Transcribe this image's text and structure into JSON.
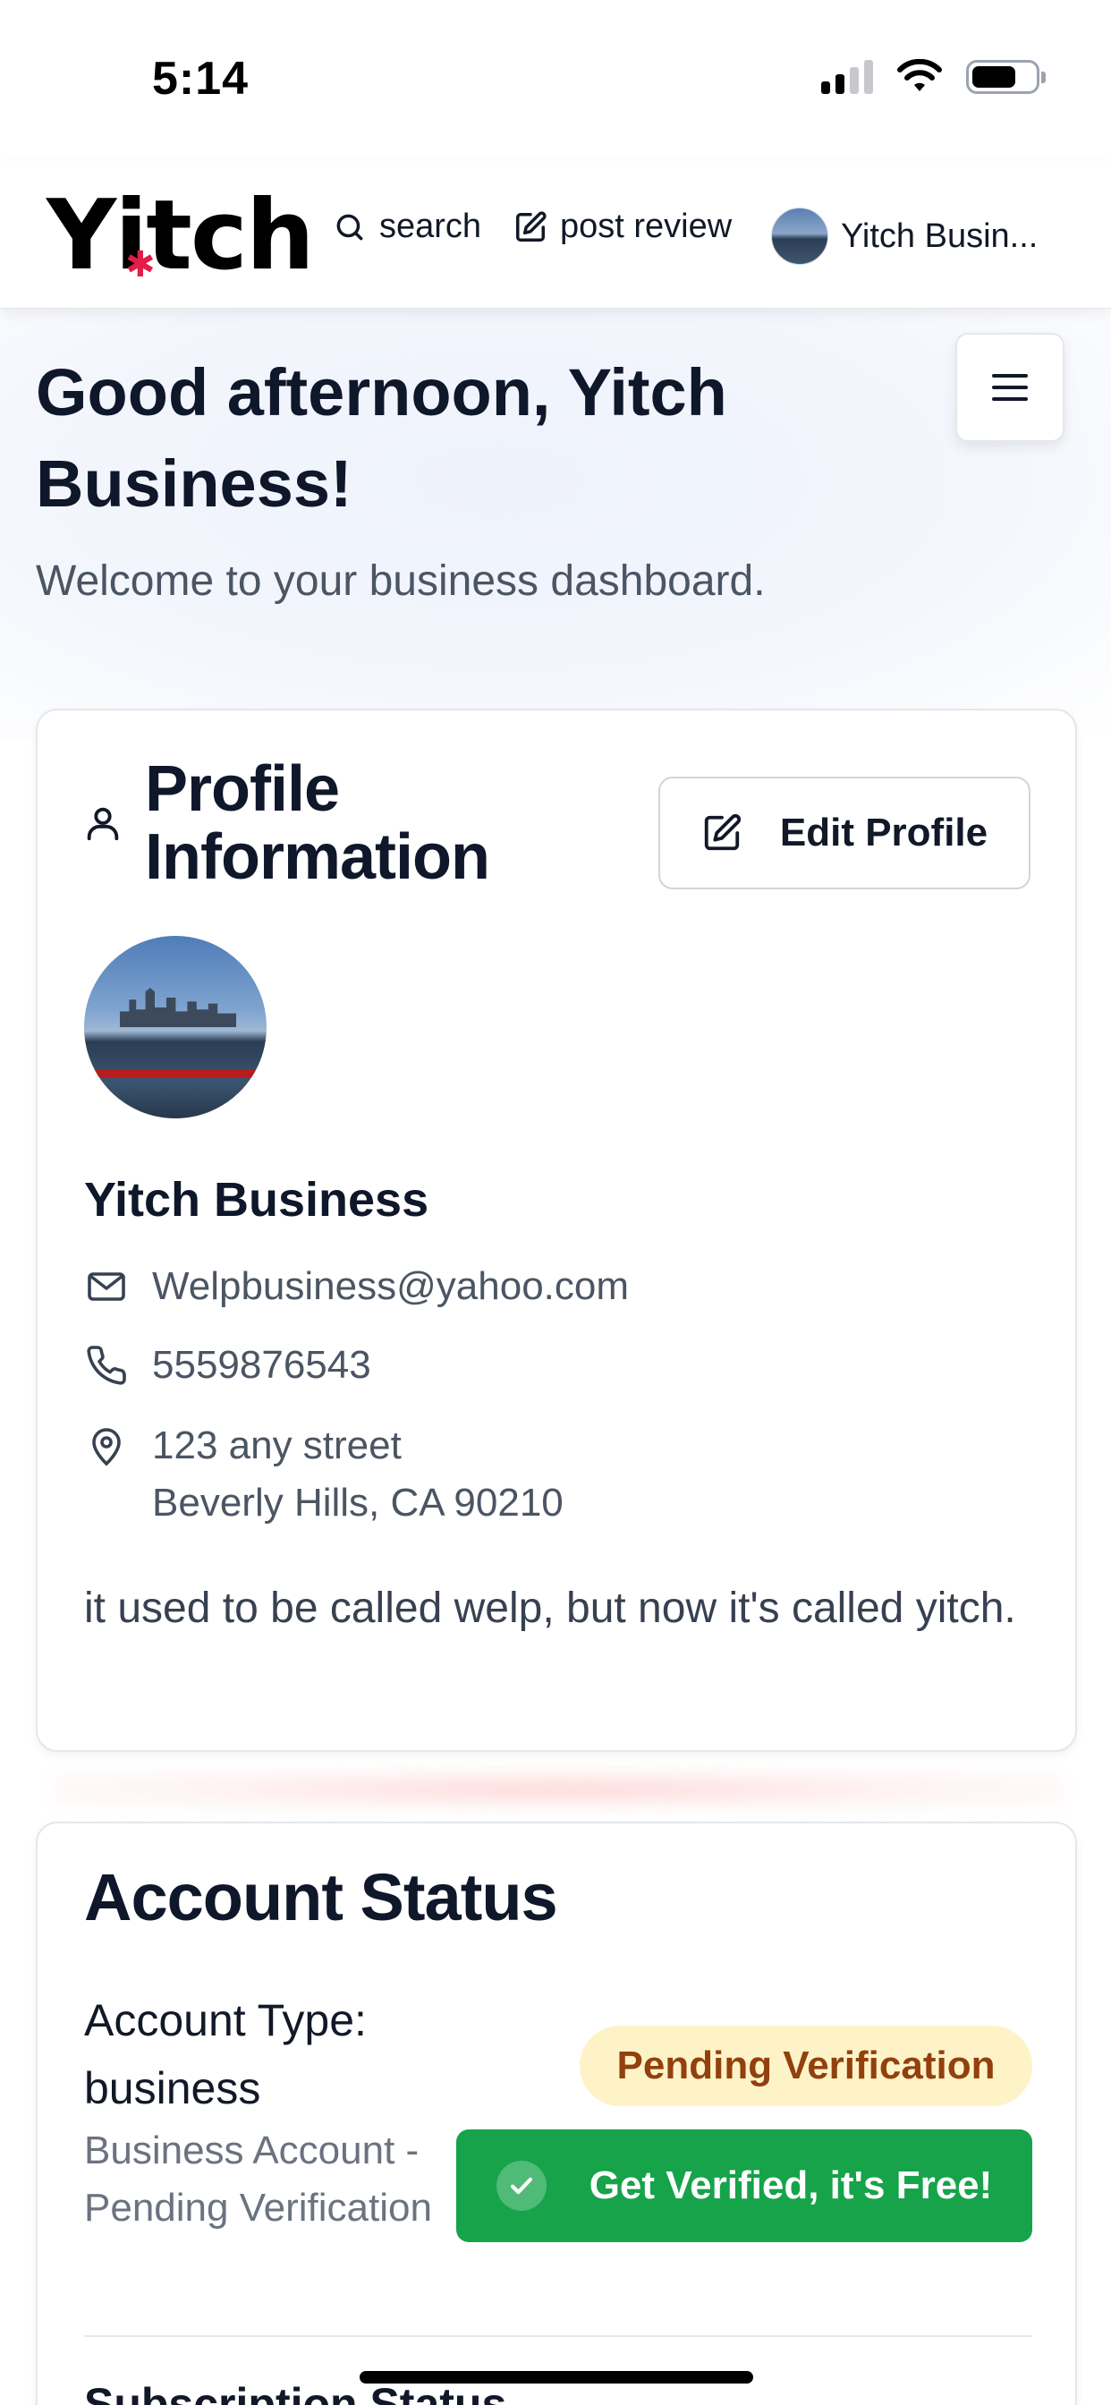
{
  "status_bar": {
    "time": "5:14"
  },
  "header": {
    "logo": "Yitch",
    "nav": {
      "search_label": "search",
      "post_review_label": "post review",
      "user_label": "Yitch Busin..."
    }
  },
  "dashboard": {
    "greeting": "Good afternoon, Yitch Business!",
    "welcome": "Welcome to your business dashboard."
  },
  "profile": {
    "title": "Profile Information",
    "edit_label": "Edit Profile",
    "name": "Yitch Business",
    "email": "Welpbusiness@yahoo.com",
    "phone": "5559876543",
    "address_line1": "123 any street",
    "address_line2": "Beverly Hills, CA 90210",
    "bio": "it used to be called welp, but now it's called yitch."
  },
  "account_status": {
    "title": "Account Status",
    "account_type": "Account Type: business",
    "subtitle": "Business Account - Pending Verification",
    "badge": "Pending Verification",
    "verify_label": "Get Verified, it's Free!",
    "next_section": "Subscription Status"
  },
  "colors": {
    "verify_green": "#16a34a",
    "pending_bg": "#fef3c7",
    "pending_text": "#92400e",
    "logo_accent": "#e11d48"
  }
}
